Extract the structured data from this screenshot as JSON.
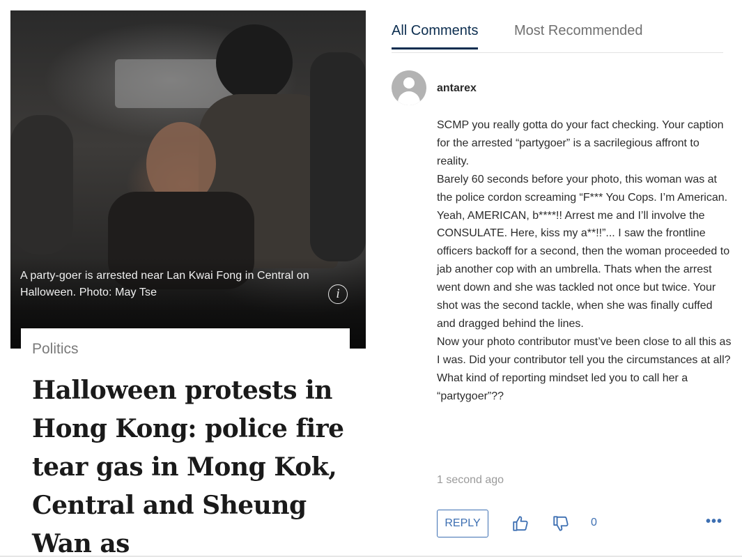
{
  "article": {
    "photo_caption": "A party-goer is arrested near Lan Kwai Fong in Central on Halloween. Photo: May Tse",
    "info_icon": "info-icon",
    "section": "Politics",
    "headline": "Halloween protests in Hong Kong: police fire tear gas in Mong Kok, Central and Sheung Wan as"
  },
  "comments": {
    "tabs": [
      {
        "label": "All Comments",
        "active": true
      },
      {
        "label": "Most Recommended",
        "active": false
      }
    ],
    "comment": {
      "avatar_icon": "user-avatar-icon",
      "username": "antarex",
      "paragraphs": [
        "SCMP you really gotta do your fact checking. Your caption for the arrested “partygoer” is a sacrilegious affront to reality.",
        "Barely 60 seconds before your photo, this woman was at the police cordon screaming “F*** You Cops. I’m American. Yeah, AMERICAN, b****!! Arrest me and I’ll involve the CONSULATE. Here, kiss my a**!!”... I saw the frontline officers backoff for a second, then the woman proceeded to jab another cop with an umbrella. Thats when the arrest went down and she was tackled not once but twice. Your shot was the second tackle, when she was finally cuffed and dragged behind the lines.",
        "Now your photo contributor must’ve been close to all this as I was. Did your contributor tell you the circumstances at all? What kind of reporting mindset led you to call her a “partygoer”??"
      ],
      "timestamp": "1 second ago",
      "reply_label": "REPLY",
      "upvote_icon": "thumbs-up-icon",
      "downvote_icon": "thumbs-down-icon",
      "vote_count": "0",
      "more_label": "•••"
    }
  },
  "colors": {
    "accent": "#3d6fb2",
    "tab_active": "#0b2d4f",
    "text": "#2b2b2b",
    "muted": "#9a9a9a"
  }
}
